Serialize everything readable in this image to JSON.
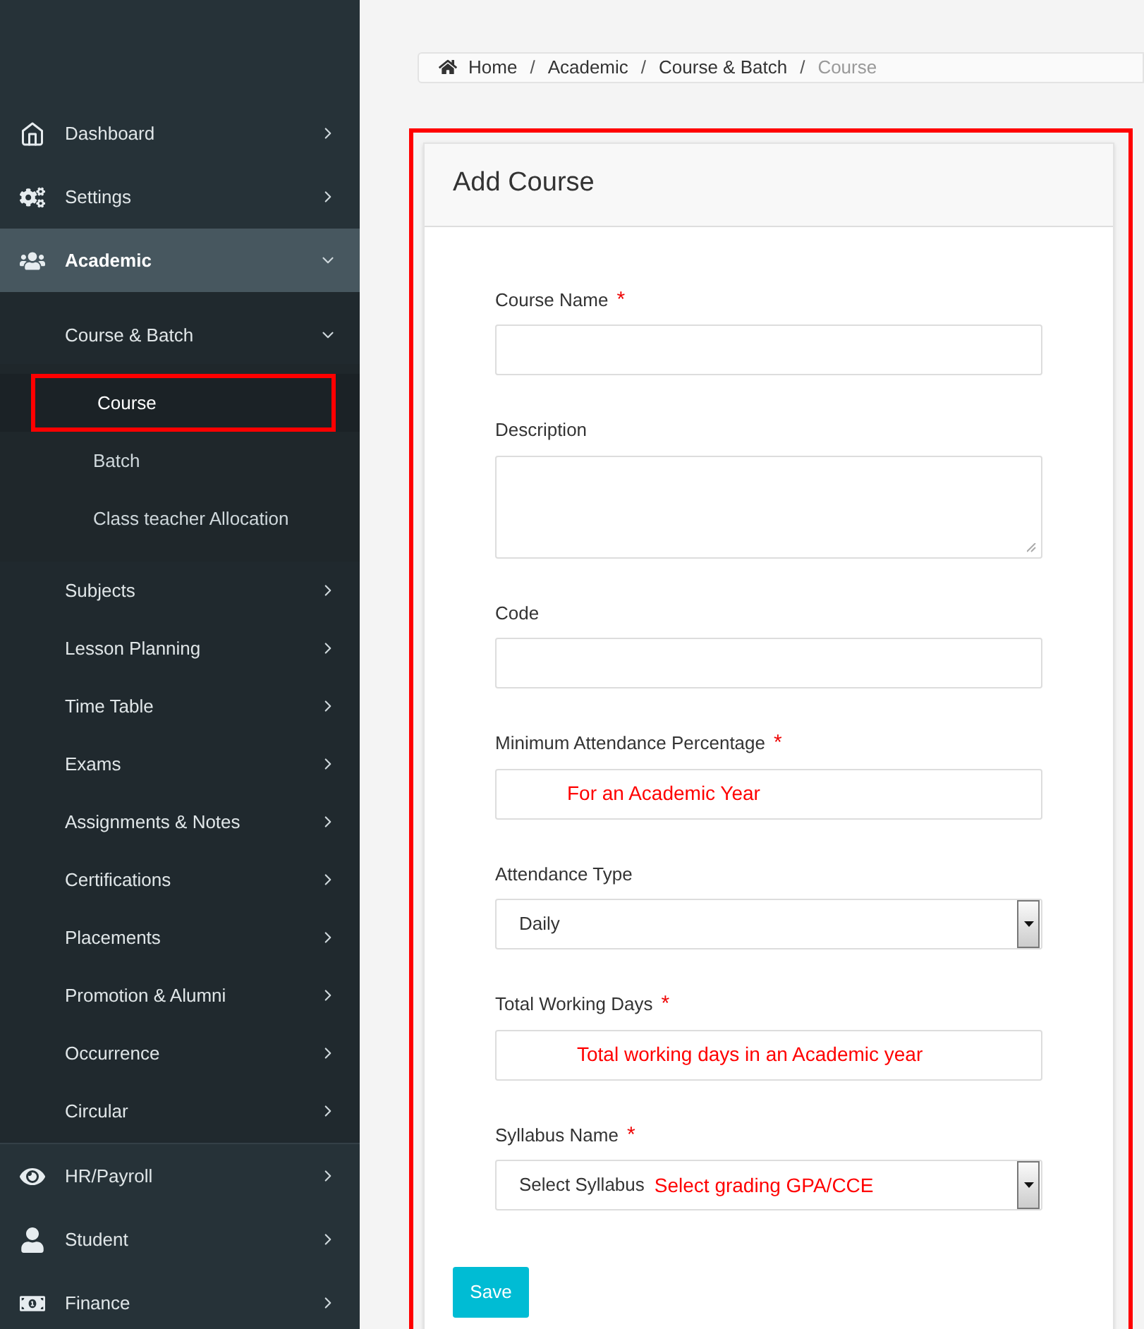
{
  "sidebar": {
    "items": [
      {
        "label": "Dashboard",
        "selected": false,
        "expanded": false
      },
      {
        "label": "Settings",
        "selected": false,
        "expanded": false
      },
      {
        "label": "Academic",
        "selected": true,
        "expanded": true,
        "children": [
          {
            "label": "Course & Batch",
            "selected": false,
            "expanded": true,
            "children": [
              {
                "label": "Course",
                "selected": true,
                "highlighted": true
              },
              {
                "label": "Batch",
                "selected": false,
                "highlighted": false
              },
              {
                "label": "Class teacher Allocation",
                "selected": false,
                "highlighted": false
              }
            ]
          },
          {
            "label": "Subjects",
            "selected": false,
            "expanded": false
          },
          {
            "label": "Lesson Planning",
            "selected": false,
            "expanded": false
          },
          {
            "label": "Time Table",
            "selected": false,
            "expanded": false
          },
          {
            "label": "Exams",
            "selected": false,
            "expanded": false
          },
          {
            "label": "Assignments & Notes",
            "selected": false,
            "expanded": false
          },
          {
            "label": "Certifications",
            "selected": false,
            "expanded": false
          },
          {
            "label": "Placements",
            "selected": false,
            "expanded": false
          },
          {
            "label": "Promotion & Alumni",
            "selected": false,
            "expanded": false
          },
          {
            "label": "Occurrence",
            "selected": false,
            "expanded": false
          },
          {
            "label": "Circular",
            "selected": false,
            "expanded": false
          }
        ]
      },
      {
        "label": "HR/Payroll",
        "selected": false,
        "expanded": false
      },
      {
        "label": "Student",
        "selected": false,
        "expanded": false
      },
      {
        "label": "Finance",
        "selected": false,
        "expanded": false
      }
    ]
  },
  "breadcrumb": {
    "separator": "/",
    "items": [
      "Home",
      "Academic",
      "Course & Batch",
      "Course"
    ]
  },
  "form": {
    "title": "Add Course",
    "highlighted": true,
    "fields": [
      {
        "kind": "input",
        "label": "Course Name",
        "required_mark": "*"
      },
      {
        "kind": "textarea",
        "label": "Description"
      },
      {
        "kind": "input",
        "label": "Code"
      },
      {
        "kind": "input",
        "label": "Minimum Attendance Percentage",
        "required_mark": "*",
        "annotation": "For an Academic Year"
      },
      {
        "kind": "select",
        "label": "Attendance Type",
        "value": "Daily"
      },
      {
        "kind": "input",
        "label": "Total Working Days",
        "required_mark": "*",
        "annotation": "Total working days in an Academic year"
      },
      {
        "kind": "select",
        "label": "Syllabus Name",
        "required_mark": "*",
        "value": "Select Syllabus",
        "annotation": "Select grading GPA/CCE"
      }
    ],
    "submit": "Save"
  }
}
